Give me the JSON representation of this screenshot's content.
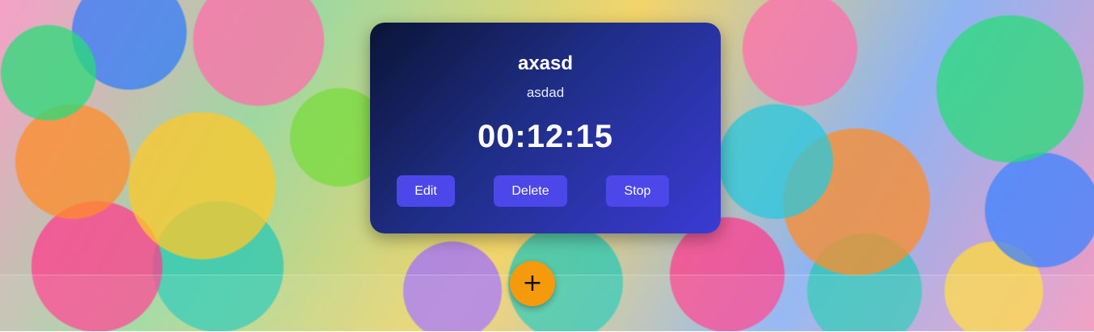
{
  "timer_card": {
    "title": "axasd",
    "description": "asdad",
    "elapsed": "00:12:15",
    "buttons": {
      "edit": "Edit",
      "delete": "Delete",
      "stop": "Stop"
    }
  },
  "add_button": {
    "icon": "plus-icon",
    "glyph": "+"
  },
  "colors": {
    "card_gradient_start": "#0b1436",
    "card_gradient_end": "#3a3bd4",
    "button_bg": "#4b47e8",
    "fab_bg": "#f59a0c"
  }
}
